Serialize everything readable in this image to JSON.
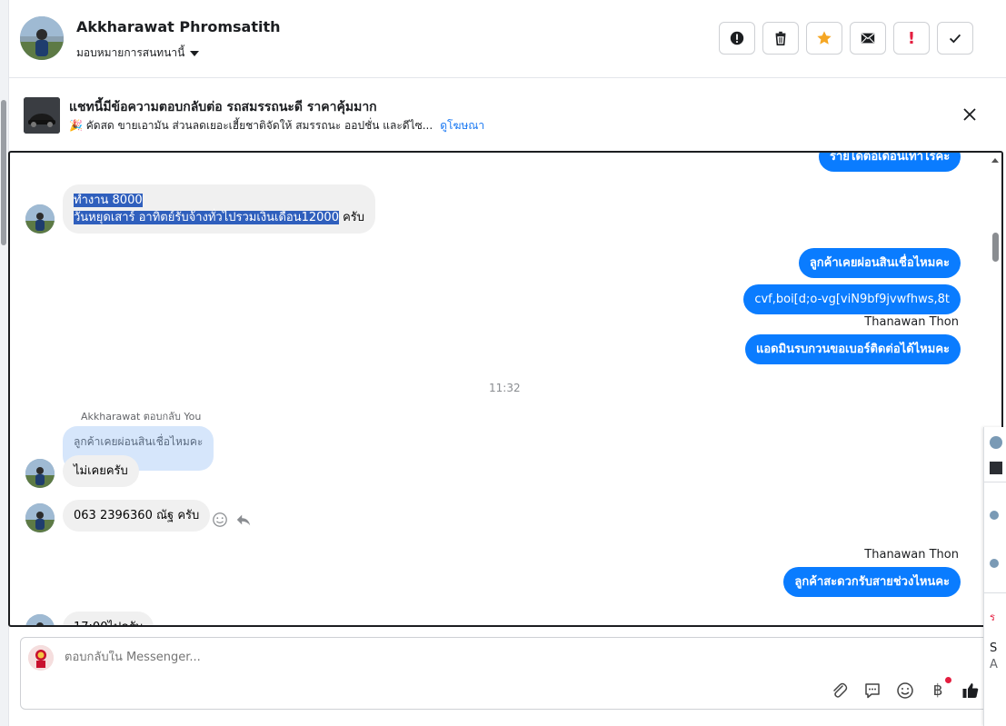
{
  "header": {
    "contact_name": "Akkharawat Phromsatith",
    "assign_label": "มอบหมายการสนทนานี้",
    "actions": [
      {
        "name": "mark-spam-button",
        "icon": "alert-circle-icon"
      },
      {
        "name": "delete-button",
        "icon": "trash-icon"
      },
      {
        "name": "star-button",
        "icon": "star-icon"
      },
      {
        "name": "mark-unread-button",
        "icon": "envelope-icon"
      },
      {
        "name": "follow-up-button",
        "icon": "exclamation-icon"
      },
      {
        "name": "mark-done-button",
        "icon": "check-icon"
      }
    ],
    "follow_up_glyph": "!"
  },
  "ad": {
    "title": "แชทนี้มีข้อความตอบกลับต่อ รถสมรรถนะดี ราคาคุ้มมาก",
    "subtitle": "🎉 คัดสด ขายเอามัน ส่วนลดเยอะเฮี้ยชาติจัดให้ สมรรถนะ ออปชั่น และดีไซ...",
    "link": "ดูโฆษณา"
  },
  "chat": {
    "msg_top_cut": "รายได้ต่อเดือนเท่าไรคะ",
    "msg_income_line1": "ทำงาน 8000",
    "msg_income_line2_selected": "วันหยุดเสาร์ อาทิตย์รับจ้างทั่วไปรวมเงินเดือน12000",
    "msg_income_line2_rest": " ครับ",
    "msg_installment_q": "ลูกค้าเคยผ่อนสินเชื่อไหมคะ",
    "msg_typo": "cvf,boi[d;o-vg[viN9bf9jvwfhws,8t",
    "sender_1": "Thanawan Thon",
    "msg_ask_number": "แอดมินรบกวนขอเบอร์ติดต่อได้ไหมคะ",
    "time_1": "11:32",
    "reply_note": "Akkharawat ตอบกลับ You",
    "quoted_text": "ลูกค้าเคยผ่อนสินเชื่อไหมคะ",
    "msg_never": "ไม่เคยครับ",
    "msg_phone": "063 2396360 ณัฐ ครับ",
    "sender_2": "Thanawan Thon",
    "msg_convenient_time": "ลูกค้าสะดวกรับสายช่วงไหนคะ",
    "msg_bottom_cut": "17:00ไปครับ"
  },
  "composer": {
    "placeholder": "ตอบกลับใน Messenger...",
    "baht_glyph": "฿",
    "tools": [
      "paperclip-icon",
      "saved-reply-icon",
      "emoji-icon",
      "baht-icon",
      "thumbs-up-icon"
    ]
  },
  "right_stub": {
    "item_letter_1": "ร",
    "item_letter_2": "S",
    "item_letter_3": "A"
  },
  "colors": {
    "outgoing_bubble": "#0a7cff",
    "incoming_bubble": "#f0f0f0",
    "selection": "#2f5fbd",
    "quoted_bubble": "#d6e6fb",
    "star": "#f5a623",
    "alert": "#e41e3f",
    "link": "#1877f2"
  }
}
